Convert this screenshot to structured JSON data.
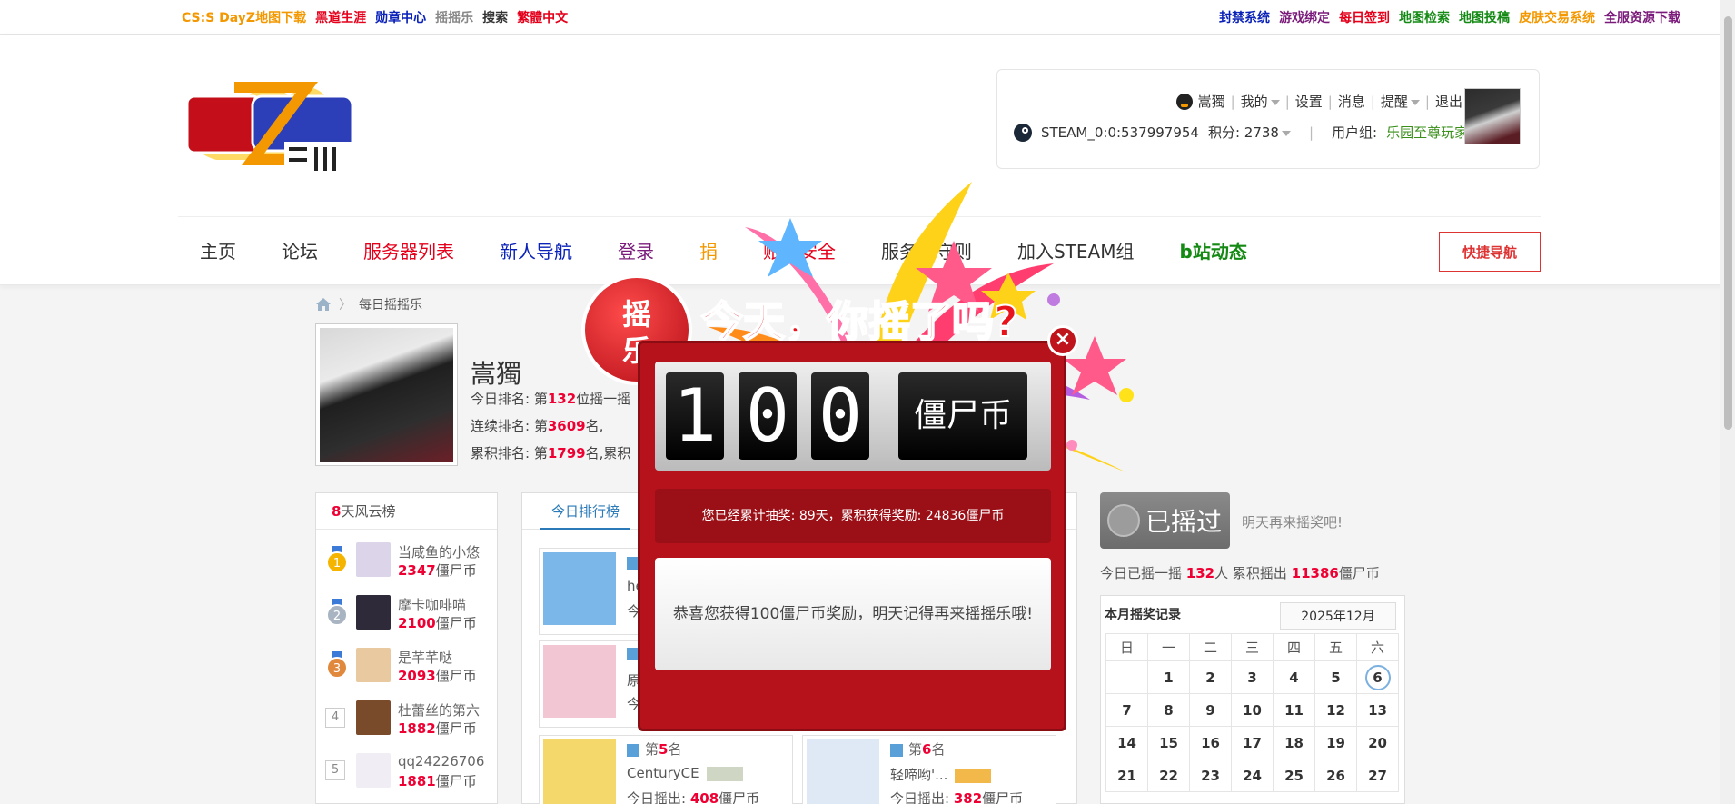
{
  "topbar": {
    "left": [
      {
        "label": "CS:S DayZ地图下载",
        "color": "#f39800"
      },
      {
        "label": "黑道生涯",
        "color": "#e4001b"
      },
      {
        "label": "勋章中心",
        "color": "#0b22b8"
      },
      {
        "label": "摇摇乐",
        "color": "#888888"
      },
      {
        "label": "搜索",
        "color": "#333333"
      },
      {
        "label": "繁體中文",
        "color": "#e4001b"
      }
    ],
    "right": [
      {
        "label": "封禁系统",
        "color": "#0b22b8"
      },
      {
        "label": "游戏绑定",
        "color": "#7a1a7a"
      },
      {
        "label": "每日签到",
        "color": "#e4001b"
      },
      {
        "label": "地图检索",
        "color": "#148a14"
      },
      {
        "label": "地图投稿",
        "color": "#148a14"
      },
      {
        "label": "皮肤交易系统",
        "color": "#f39800"
      },
      {
        "label": "全服资源下载",
        "color": "#7a1a7a"
      }
    ]
  },
  "user": {
    "name": "嵩獨",
    "menu": [
      "我的",
      "设置",
      "消息",
      "提醒",
      "退出"
    ],
    "steam_id": "STEAM_0:0:537997954",
    "points_label": "积分: 2738",
    "group_label": "用户组:",
    "group": "乐园至尊玩家"
  },
  "nav": {
    "items": [
      {
        "label": "主页",
        "color": "#333333"
      },
      {
        "label": "论坛",
        "color": "#333333"
      },
      {
        "label": "服务器列表",
        "color": "#e4001b"
      },
      {
        "label": "新人导航",
        "color": "#0b22b8"
      },
      {
        "label": "登录",
        "color": "#7a1a7a"
      },
      {
        "label": "捐",
        "color": "#f39800"
      },
      {
        "label": "账号安全",
        "color": "#e4001b"
      },
      {
        "label": "服务器守则",
        "color": "#333333"
      },
      {
        "label": "加入STEAM组",
        "color": "#333333"
      },
      {
        "label": "b站动态",
        "color": "#148a14"
      }
    ],
    "quick": "快捷导航"
  },
  "breadcrumb": {
    "current": "每日摇摇乐"
  },
  "profile": {
    "name": "嵩獨",
    "today_rank": {
      "prefix": "今日排名: 第",
      "value": "132",
      "suffix": "位摇一摇"
    },
    "streak_rank": {
      "prefix": "连续排名: 第",
      "value": "3609",
      "suffix": "名,"
    },
    "total_rank": {
      "prefix": "累积排名: 第",
      "value": "1799",
      "suffix": "名,累积"
    }
  },
  "leaderboard": {
    "title_num": "8",
    "title_text": "天风云榜",
    "items": [
      {
        "rank": "1",
        "name": "当咸鱼的小悠",
        "coins": "2347",
        "unit": "僵尸币"
      },
      {
        "rank": "2",
        "name": "摩卡咖啡喵",
        "coins": "2100",
        "unit": "僵尸币"
      },
      {
        "rank": "3",
        "name": "是芊芊哒",
        "coins": "2093",
        "unit": "僵尸币"
      },
      {
        "rank": "4",
        "name": "杜蕾丝的第六",
        "coins": "1882",
        "unit": "僵尸币"
      },
      {
        "rank": "5",
        "name": "qq24226706",
        "coins": "1881",
        "unit": "僵尸币"
      }
    ]
  },
  "today": {
    "tab": "今日排行榜",
    "cards": [
      {
        "rank_prefix": "第",
        "rank": "",
        "rank_suffix": "",
        "name": "he",
        "out_prefix": "今",
        "out": "",
        "unit": ""
      },
      {
        "rank_prefix": "",
        "rank": "",
        "rank_suffix": "",
        "name": "原",
        "out_prefix": "今",
        "out": "",
        "unit": ""
      },
      {
        "rank_prefix": "第",
        "rank": "5",
        "rank_suffix": "名",
        "name": "CenturyCE",
        "out_prefix": "今日摇出: ",
        "out": "408",
        "unit": "僵尸币"
      },
      {
        "rank_prefix": "第",
        "rank": "6",
        "rank_suffix": "名",
        "name": "轻啼哟'...",
        "out_prefix": "今日摇出: ",
        "out": "382",
        "unit": "僵尸币"
      }
    ]
  },
  "shake": {
    "done_label": "已摇过",
    "tomorrow": "明天再来摇奖吧!",
    "today_prefix": "今日已摇一摇 ",
    "today_count": "132",
    "today_mid": "人 累积摇出 ",
    "total": "11386",
    "unit": "僵尸币"
  },
  "calendar": {
    "title": "本月摇奖记录",
    "month": "2025年12月",
    "weekdays": [
      "日",
      "一",
      "二",
      "三",
      "四",
      "五",
      "六"
    ],
    "weeks": [
      [
        "",
        "1",
        "2",
        "3",
        "4",
        "5",
        "6"
      ],
      [
        "7",
        "8",
        "9",
        "10",
        "11",
        "12",
        "13"
      ],
      [
        "14",
        "15",
        "16",
        "17",
        "18",
        "19",
        "20"
      ],
      [
        "21",
        "22",
        "23",
        "24",
        "25",
        "26",
        "27"
      ]
    ],
    "today": "6"
  },
  "popup": {
    "headline": "今天，你摇了吗?",
    "badge_top": "摇",
    "badge_bottom": "乐",
    "digits": [
      "1",
      "0",
      "0"
    ],
    "unit": "僵尸币",
    "summary": "您已经累计抽奖: 89天，累积获得奖励: 24836僵尸币",
    "message": "恭喜您获得100僵尸币奖励，明天记得再来摇摇乐哦!",
    "close": "×"
  }
}
